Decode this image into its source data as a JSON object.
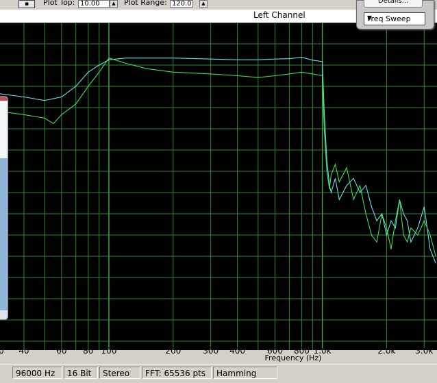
{
  "toolbar": {
    "plot_top_label": "Plot Top:",
    "plot_top_value": "10.00",
    "plot_range_label": "Plot Range:",
    "plot_range_value": "120.0"
  },
  "channel_title": "Left Channel",
  "controls": {
    "details_label": "Details...",
    "mode_selected": "Freq Sweep"
  },
  "chart_data": {
    "type": "line",
    "xlabel": "Frequency (Hz)",
    "x_scale": "log",
    "xlim": [
      30,
      3500
    ],
    "x_ticks": [
      40,
      60,
      80,
      100,
      200,
      300,
      400,
      600,
      800,
      1000,
      2000,
      3000
    ],
    "x_tick_labels": [
      "40",
      "60",
      "80",
      "100",
      "200",
      "300",
      "400",
      "600",
      "800",
      "1.0k",
      "2.0k",
      "3.0k"
    ],
    "grid": true,
    "colors": {
      "cyan": "#66e0e8",
      "green": "#40e050",
      "grid": "#2f8a2f"
    },
    "series": [
      {
        "color": "cyan",
        "x": [
          30,
          40,
          50,
          60,
          70,
          80,
          90,
          100,
          120,
          150,
          200,
          300,
          400,
          500,
          600,
          700,
          800,
          900,
          1000,
          1020,
          1050,
          1080,
          1100,
          1150,
          1200,
          1300,
          1400,
          1500,
          1600,
          1700,
          1800,
          1900,
          2000,
          2100,
          2200,
          2300,
          2400,
          2500,
          2600,
          2800,
          3000,
          3200,
          3400
        ],
        "y": [
          -10.0,
          -11.0,
          -12.0,
          -11.0,
          -8.0,
          -4.0,
          -2.0,
          -0.5,
          0.0,
          0.0,
          0.0,
          -0.3,
          -0.5,
          -0.5,
          -0.3,
          -0.2,
          0.2,
          -0.6,
          -1.0,
          -15.0,
          -29.0,
          -36.0,
          -38.0,
          -34.0,
          -40.0,
          -36.0,
          -34.0,
          -38.0,
          -36.0,
          -42.0,
          -46.0,
          -44.0,
          -50.0,
          -46.0,
          -48.0,
          -40.0,
          -44.0,
          -46.0,
          -52.0,
          -48.0,
          -42.0,
          -54.0,
          -58.0
        ]
      },
      {
        "color": "green",
        "x": [
          30,
          40,
          50,
          55,
          60,
          70,
          80,
          90,
          100,
          120,
          150,
          200,
          300,
          400,
          500,
          600,
          700,
          800,
          900,
          1000,
          1020,
          1050,
          1080,
          1100,
          1150,
          1200,
          1300,
          1400,
          1500,
          1600,
          1700,
          1800,
          1900,
          2000,
          2100,
          2200,
          2300,
          2400,
          2500,
          2600,
          2800,
          3000,
          3200,
          3400
        ],
        "y": [
          -15.0,
          -16.0,
          -17.0,
          -18.5,
          -16.0,
          -13.0,
          -8.0,
          -4.0,
          0.0,
          -1.5,
          -3.0,
          -4.0,
          -4.5,
          -5.0,
          -5.5,
          -5.0,
          -4.5,
          -4.0,
          -4.5,
          -5.0,
          -20.0,
          -32.0,
          -37.0,
          -33.0,
          -30.0,
          -35.0,
          -31.0,
          -40.0,
          -36.0,
          -44.0,
          -50.0,
          -52.0,
          -44.0,
          -48.0,
          -54.0,
          -46.0,
          -40.0,
          -50.0,
          -52.0,
          -48.0,
          -50.0,
          -46.0,
          -50.0,
          -56.0
        ]
      }
    ]
  },
  "status": {
    "sample_rate": "96000 Hz",
    "bit_depth": "16 Bit",
    "channels": "Stereo",
    "fft": "FFT: 65536 pts",
    "window": "Hamming"
  }
}
